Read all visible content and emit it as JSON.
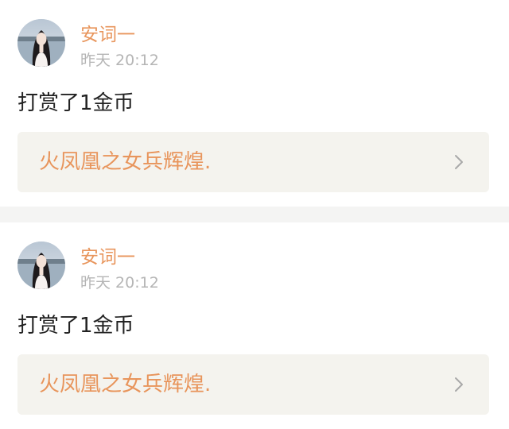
{
  "colors": {
    "accent": "#e8955c",
    "timestamp": "#b5b5b5",
    "message_text": "#222222",
    "link_box_bg": "#f4f3ee",
    "divider": "#f4f4f3"
  },
  "posts": [
    {
      "username": "安词一",
      "timestamp": "昨天 20:12",
      "message": "打赏了1金币",
      "link_title": "火凤凰之女兵辉煌.",
      "link_icon": "chevron-right-icon"
    },
    {
      "username": "安词一",
      "timestamp": "昨天 20:12",
      "message": "打赏了1金币",
      "link_title": "火凤凰之女兵辉煌.",
      "link_icon": "chevron-right-icon"
    }
  ]
}
